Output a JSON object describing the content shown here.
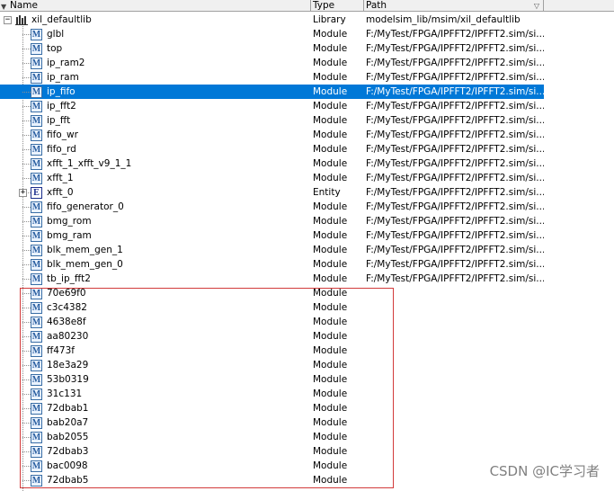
{
  "header": {
    "name": "Name",
    "type": "Type",
    "path": "Path",
    "sort_indicator": "▼",
    "filter_indicator": "▽"
  },
  "library": {
    "name": "xil_defaultlib",
    "type": "Library",
    "path": "modelsim_lib/msim/xil_defaultlib",
    "expander": "−",
    "icon": "library-icon"
  },
  "rows": [
    {
      "name": "glbl",
      "type": "Module",
      "path": "F:/MyTest/FPGA/IPFFT2/IPFFT2.sim/si...",
      "icon": "M"
    },
    {
      "name": "top",
      "type": "Module",
      "path": "F:/MyTest/FPGA/IPFFT2/IPFFT2.sim/si...",
      "icon": "M"
    },
    {
      "name": "ip_ram2",
      "type": "Module",
      "path": "F:/MyTest/FPGA/IPFFT2/IPFFT2.sim/si...",
      "icon": "M"
    },
    {
      "name": "ip_ram",
      "type": "Module",
      "path": "F:/MyTest/FPGA/IPFFT2/IPFFT2.sim/si...",
      "icon": "M"
    },
    {
      "name": "ip_fifo",
      "type": "Module",
      "path": "F:/MyTest/FPGA/IPFFT2/IPFFT2.sim/si...",
      "icon": "M",
      "selected": true
    },
    {
      "name": "ip_fft2",
      "type": "Module",
      "path": "F:/MyTest/FPGA/IPFFT2/IPFFT2.sim/si...",
      "icon": "M"
    },
    {
      "name": "ip_fft",
      "type": "Module",
      "path": "F:/MyTest/FPGA/IPFFT2/IPFFT2.sim/si...",
      "icon": "M"
    },
    {
      "name": "fifo_wr",
      "type": "Module",
      "path": "F:/MyTest/FPGA/IPFFT2/IPFFT2.sim/si...",
      "icon": "M"
    },
    {
      "name": "fifo_rd",
      "type": "Module",
      "path": "F:/MyTest/FPGA/IPFFT2/IPFFT2.sim/si...",
      "icon": "M"
    },
    {
      "name": "xfft_1_xfft_v9_1_1",
      "type": "Module",
      "path": "F:/MyTest/FPGA/IPFFT2/IPFFT2.sim/si...",
      "icon": "M"
    },
    {
      "name": "xfft_1",
      "type": "Module",
      "path": "F:/MyTest/FPGA/IPFFT2/IPFFT2.sim/si...",
      "icon": "M"
    },
    {
      "name": "xfft_0",
      "type": "Entity",
      "path": "F:/MyTest/FPGA/IPFFT2/IPFFT2.sim/si...",
      "icon": "E",
      "expander": "+"
    },
    {
      "name": "fifo_generator_0",
      "type": "Module",
      "path": "F:/MyTest/FPGA/IPFFT2/IPFFT2.sim/si...",
      "icon": "M"
    },
    {
      "name": "bmg_rom",
      "type": "Module",
      "path": "F:/MyTest/FPGA/IPFFT2/IPFFT2.sim/si...",
      "icon": "M"
    },
    {
      "name": "bmg_ram",
      "type": "Module",
      "path": "F:/MyTest/FPGA/IPFFT2/IPFFT2.sim/si...",
      "icon": "M"
    },
    {
      "name": "blk_mem_gen_1",
      "type": "Module",
      "path": "F:/MyTest/FPGA/IPFFT2/IPFFT2.sim/si...",
      "icon": "M"
    },
    {
      "name": "blk_mem_gen_0",
      "type": "Module",
      "path": "F:/MyTest/FPGA/IPFFT2/IPFFT2.sim/si...",
      "icon": "M"
    },
    {
      "name": "tb_ip_fft2",
      "type": "Module",
      "path": "F:/MyTest/FPGA/IPFFT2/IPFFT2.sim/si...",
      "icon": "M"
    },
    {
      "name": "70e69f0",
      "type": "Module",
      "path": "",
      "icon": "M"
    },
    {
      "name": "c3c4382",
      "type": "Module",
      "path": "",
      "icon": "M"
    },
    {
      "name": "4638e8f",
      "type": "Module",
      "path": "",
      "icon": "M"
    },
    {
      "name": "aa80230",
      "type": "Module",
      "path": "",
      "icon": "M"
    },
    {
      "name": "ff473f",
      "type": "Module",
      "path": "",
      "icon": "M"
    },
    {
      "name": "18e3a29",
      "type": "Module",
      "path": "",
      "icon": "M"
    },
    {
      "name": "53b0319",
      "type": "Module",
      "path": "",
      "icon": "M"
    },
    {
      "name": "31c131",
      "type": "Module",
      "path": "",
      "icon": "M"
    },
    {
      "name": "72dbab1",
      "type": "Module",
      "path": "",
      "icon": "M"
    },
    {
      "name": "bab20a7",
      "type": "Module",
      "path": "",
      "icon": "M"
    },
    {
      "name": "bab2055",
      "type": "Module",
      "path": "",
      "icon": "M"
    },
    {
      "name": "72dbab3",
      "type": "Module",
      "path": "",
      "icon": "M"
    },
    {
      "name": "bac0098",
      "type": "Module",
      "path": "",
      "icon": "M"
    },
    {
      "name": "72dbab5",
      "type": "Module",
      "path": "",
      "icon": "M"
    }
  ],
  "watermark": "CSDN @IC学习者",
  "colors": {
    "selection": "#0078d7",
    "highlight_box": "#d23b3b",
    "module_icon": "#3a6ea5",
    "entity_icon": "#1a2d8c"
  }
}
